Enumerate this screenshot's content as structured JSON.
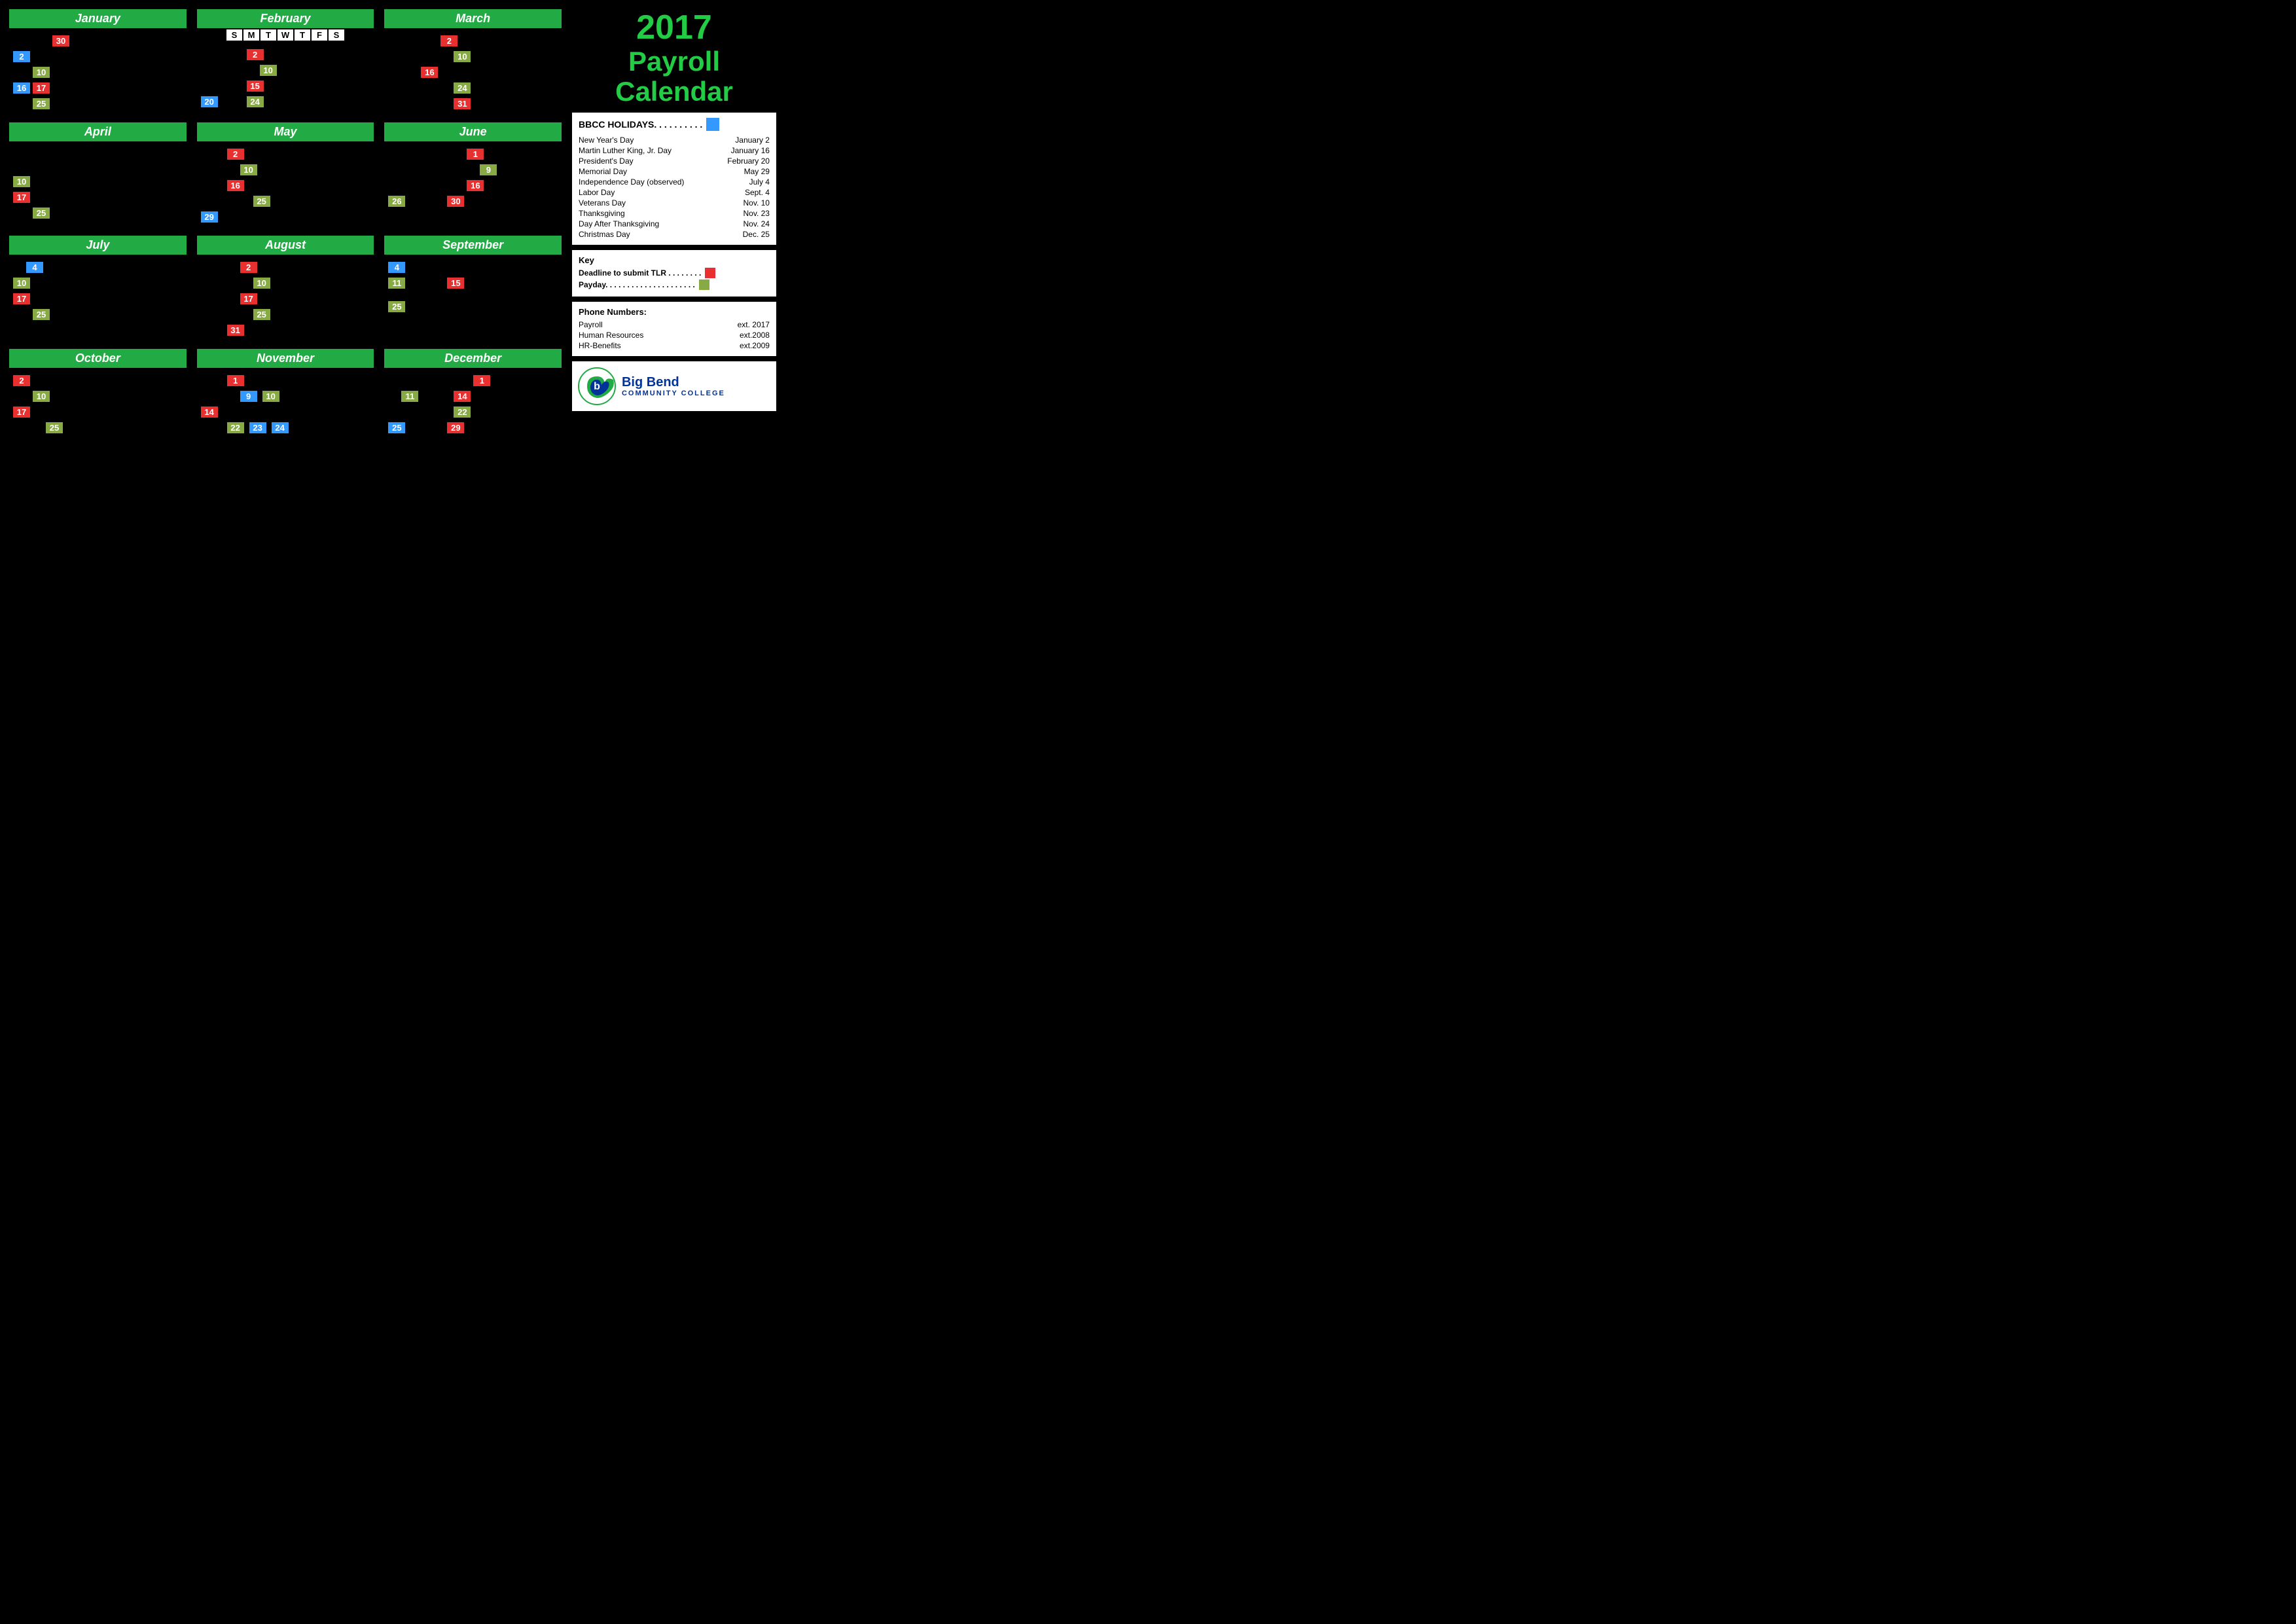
{
  "title": "2017 Payroll Calendar",
  "year": "2017",
  "months": [
    {
      "name": "January",
      "dates": [
        {
          "value": "30",
          "type": "red",
          "indent": 3
        },
        {
          "value": "2",
          "type": "blue",
          "indent": 0
        },
        {
          "value": "10",
          "type": "green",
          "indent": 2
        },
        {
          "value": "16",
          "type": "blue",
          "indent": 0
        },
        {
          "value": "17",
          "type": "red",
          "indent": 1
        },
        {
          "value": "25",
          "type": "green",
          "indent": 2
        }
      ]
    },
    {
      "name": "February",
      "dates": [
        {
          "value": "2",
          "type": "red",
          "indent": 3
        },
        {
          "value": "10",
          "type": "green",
          "indent": 4
        },
        {
          "value": "15",
          "type": "red",
          "indent": 3
        },
        {
          "value": "20",
          "type": "blue",
          "indent": 0
        },
        {
          "value": "24",
          "type": "green",
          "indent": 4
        }
      ]
    },
    {
      "name": "March",
      "dates": [
        {
          "value": "2",
          "type": "red",
          "indent": 3
        },
        {
          "value": "10",
          "type": "green",
          "indent": 4
        },
        {
          "value": "16",
          "type": "red",
          "indent": 2
        },
        {
          "value": "24",
          "type": "green",
          "indent": 4
        },
        {
          "value": "31",
          "type": "red",
          "indent": 4
        }
      ]
    },
    {
      "name": "April",
      "dates": [
        {
          "value": "10",
          "type": "green",
          "indent": 0
        },
        {
          "value": "17",
          "type": "red",
          "indent": 0
        },
        {
          "value": "25",
          "type": "green",
          "indent": 2
        }
      ]
    },
    {
      "name": "May",
      "dates": [
        {
          "value": "2",
          "type": "red",
          "indent": 2
        },
        {
          "value": "10",
          "type": "green",
          "indent": 3
        },
        {
          "value": "16",
          "type": "red",
          "indent": 2
        },
        {
          "value": "25",
          "type": "green",
          "indent": 4
        },
        {
          "value": "29",
          "type": "blue",
          "indent": 0
        }
      ]
    },
    {
      "name": "June",
      "dates": [
        {
          "value": "1",
          "type": "red",
          "indent": 4
        },
        {
          "value": "9",
          "type": "green",
          "indent": 5
        },
        {
          "value": "16",
          "type": "red",
          "indent": 4
        },
        {
          "value": "26",
          "type": "green",
          "indent": 0
        },
        {
          "value": "30",
          "type": "red",
          "indent": 4
        }
      ]
    },
    {
      "name": "July",
      "dates": [
        {
          "value": "4",
          "type": "blue",
          "indent": 1
        },
        {
          "value": "10",
          "type": "green",
          "indent": 0
        },
        {
          "value": "17",
          "type": "red",
          "indent": 0
        },
        {
          "value": "25",
          "type": "green",
          "indent": 2
        }
      ]
    },
    {
      "name": "August",
      "dates": [
        {
          "value": "2",
          "type": "red",
          "indent": 3
        },
        {
          "value": "10",
          "type": "green",
          "indent": 4
        },
        {
          "value": "17",
          "type": "red",
          "indent": 3
        },
        {
          "value": "25",
          "type": "green",
          "indent": 4
        },
        {
          "value": "31",
          "type": "red",
          "indent": 2
        }
      ]
    },
    {
      "name": "September",
      "dates": [
        {
          "value": "4",
          "type": "blue",
          "indent": 0
        },
        {
          "value": "11",
          "type": "green",
          "indent": 0
        },
        {
          "value": "15",
          "type": "red",
          "indent": 4
        },
        {
          "value": "25",
          "type": "green",
          "indent": 0
        }
      ]
    },
    {
      "name": "October",
      "dates": [
        {
          "value": "2",
          "type": "red",
          "indent": 0
        },
        {
          "value": "10",
          "type": "green",
          "indent": 2
        },
        {
          "value": "17",
          "type": "red",
          "indent": 0
        },
        {
          "value": "25",
          "type": "green",
          "indent": 3
        }
      ]
    },
    {
      "name": "November",
      "dates": [
        {
          "value": "1",
          "type": "red",
          "indent": 2
        },
        {
          "value": "9",
          "type": "blue",
          "indent": 3
        },
        {
          "value": "10",
          "type": "green",
          "indent": 4
        },
        {
          "value": "14",
          "type": "red",
          "indent": 0
        },
        {
          "value": "22",
          "type": "green",
          "indent": 2
        },
        {
          "value": "23",
          "type": "blue",
          "indent": 3
        },
        {
          "value": "24",
          "type": "blue",
          "indent": 4
        }
      ]
    },
    {
      "name": "December",
      "dates": [
        {
          "value": "1",
          "type": "red",
          "indent": 5
        },
        {
          "value": "11",
          "type": "green",
          "indent": 1
        },
        {
          "value": "14",
          "type": "red",
          "indent": 4
        },
        {
          "value": "22",
          "type": "green",
          "indent": 4
        },
        {
          "value": "25",
          "type": "blue",
          "indent": 0
        },
        {
          "value": "29",
          "type": "red",
          "indent": 4
        }
      ]
    }
  ],
  "holidays": [
    {
      "name": "New Year's Day",
      "date": "January 2"
    },
    {
      "name": "Martin Luther King, Jr. Day",
      "date": "January 16"
    },
    {
      "name": "President's Day",
      "date": "February 20"
    },
    {
      "name": "Memorial Day",
      "date": "May 29"
    },
    {
      "name": "Independence Day (observed)",
      "date": "July 4"
    },
    {
      "name": "Labor Day",
      "date": "Sept. 4"
    },
    {
      "name": "Veterans Day",
      "date": "Nov. 10"
    },
    {
      "name": "Thanksgiving",
      "date": "Nov. 23"
    },
    {
      "name": "Day After Thanksgiving",
      "date": "Nov. 24"
    },
    {
      "name": "Christmas Day",
      "date": "Dec. 25"
    }
  ],
  "key": {
    "title": "Key",
    "tlr_label": "Deadline to submit TLR . . . . . . . .",
    "payday_label": "Payday. . . . . . . . . . . . . . . . . . . . ."
  },
  "phone": {
    "title": "Phone Numbers:",
    "items": [
      {
        "label": "Payroll",
        "value": "ext. 2017"
      },
      {
        "label": "Human Resources",
        "value": "ext.2008"
      },
      {
        "label": "HR-Benefits",
        "value": "ext.2009"
      }
    ]
  },
  "logo": {
    "name": "Big Bend",
    "subtitle": "COMMUNITY COLLEGE"
  },
  "feb_days": [
    "S",
    "M",
    "T",
    "W",
    "T",
    "F",
    "S"
  ]
}
